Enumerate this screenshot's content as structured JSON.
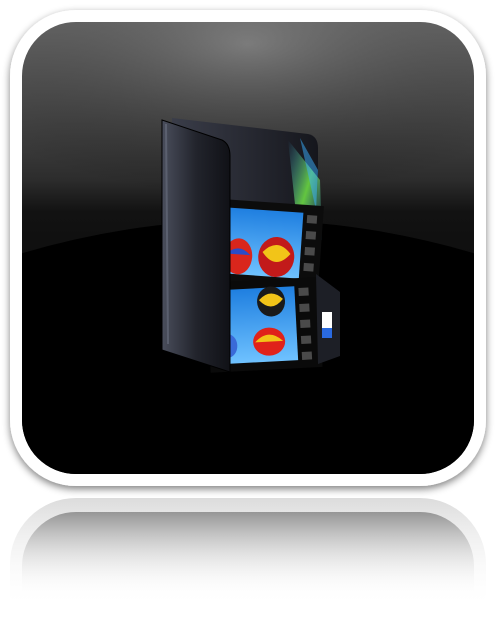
{
  "icon": {
    "name": "video-folder-icon",
    "frame_color": "#ffffff",
    "tile_top_color": "#6a6a6a",
    "tile_bottom_color": "#000000",
    "folder_color": "#1c1e26",
    "film_color": "#0a0a0a",
    "photo_sky_color": "#2a8fe0",
    "highlight_color_green": "#7cff4a",
    "highlight_color_blue": "#3ab0ff"
  }
}
